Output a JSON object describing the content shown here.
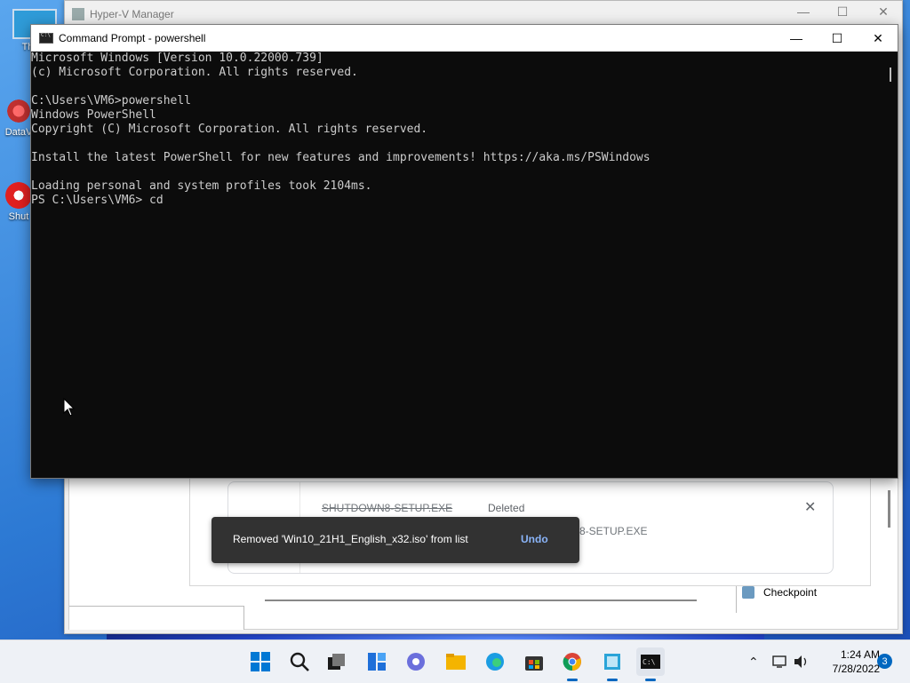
{
  "desktop": {
    "icons": [
      {
        "label": "Th",
        "icon": "this-pc-icon"
      },
      {
        "label": "DataV",
        "icon": "datavault-icon"
      },
      {
        "label": "Shut",
        "icon": "shutdown-icon"
      }
    ]
  },
  "hyperv": {
    "title": "Hyper-V Manager",
    "actions_item": "Checkpoint"
  },
  "downloads": {
    "file_name": "SHUTDOWN8-SETUP.EXE",
    "status": "Deleted",
    "second_name_partial": "8-SETUP.EXE"
  },
  "toast": {
    "message": "Removed 'Win10_21H1_English_x32.iso' from list",
    "action": "Undo"
  },
  "cmd": {
    "title": "Command Prompt - powershell",
    "lines": [
      "Microsoft Windows [Version 10.0.22000.739]",
      "(c) Microsoft Corporation. All rights reserved.",
      "",
      "C:\\Users\\VM6>powershell",
      "Windows PowerShell",
      "Copyright (C) Microsoft Corporation. All rights reserved.",
      "",
      "Install the latest PowerShell for new features and improvements! https://aka.ms/PSWindows",
      "",
      "Loading personal and system profiles took 2104ms.",
      "PS C:\\Users\\VM6> cd"
    ]
  },
  "taskbar": {
    "apps": [
      "start-icon",
      "search-icon",
      "task-view-icon",
      "widgets-icon",
      "teams-chat-icon",
      "file-explorer-icon",
      "edge-icon",
      "store-icon",
      "chrome-icon",
      "hyperv-icon",
      "cmd-icon"
    ],
    "time": "1:24 AM",
    "date": "7/28/2022",
    "notification_count": "3"
  }
}
